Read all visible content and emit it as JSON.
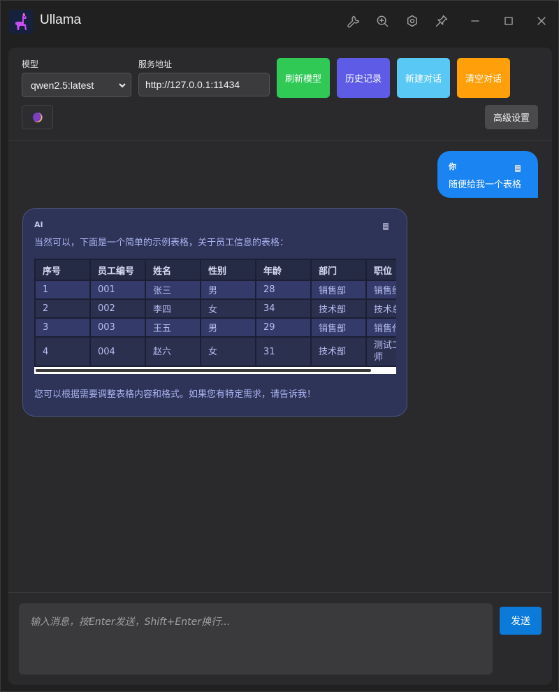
{
  "app": {
    "title": "Ullama"
  },
  "titlebar": {
    "icons": [
      "wrench-icon",
      "zoom-in-icon",
      "settings-hex-icon",
      "pin-icon",
      "minimize-icon",
      "maximize-icon",
      "close-icon"
    ]
  },
  "toolbar": {
    "model_label": "模型",
    "model_value": "qwen2.5:latest",
    "url_label": "服务地址",
    "url_value": "http://127.0.0.1:11434",
    "refresh_label": "刷新模型",
    "history_label": "历史记录",
    "new_chat_label": "新建对话",
    "clear_label": "清空对话",
    "advanced_label": "高级设置",
    "colors": {
      "refresh": "#30c956",
      "history": "#5e5ce6",
      "new_chat": "#5ac8f5",
      "clear": "#ff9f0a"
    }
  },
  "messages": [
    {
      "role": "你",
      "text": "随便给我一个表格"
    },
    {
      "role": "AI",
      "intro": "当然可以，下面是一个简单的示例表格，关于员工信息的表格：",
      "outro": "您可以根据需要调整表格内容和格式。如果您有特定需求，请告诉我！",
      "table": {
        "headers": [
          "序号",
          "员工编号",
          "姓名",
          "性别",
          "年龄",
          "部门",
          "职位"
        ],
        "rows": [
          [
            "1",
            "001",
            "张三",
            "男",
            "28",
            "销售部",
            "销售经"
          ],
          [
            "2",
            "002",
            "李四",
            "女",
            "34",
            "技术部",
            "技术总"
          ],
          [
            "3",
            "003",
            "王五",
            "男",
            "29",
            "销售部",
            "销售代"
          ],
          [
            "4",
            "004",
            "赵六",
            "女",
            "31",
            "技术部",
            "测试工程师"
          ]
        ]
      }
    }
  ],
  "composer": {
    "placeholder": "输入消息，按Enter发送，Shift+Enter换行...",
    "send_label": "发送"
  }
}
